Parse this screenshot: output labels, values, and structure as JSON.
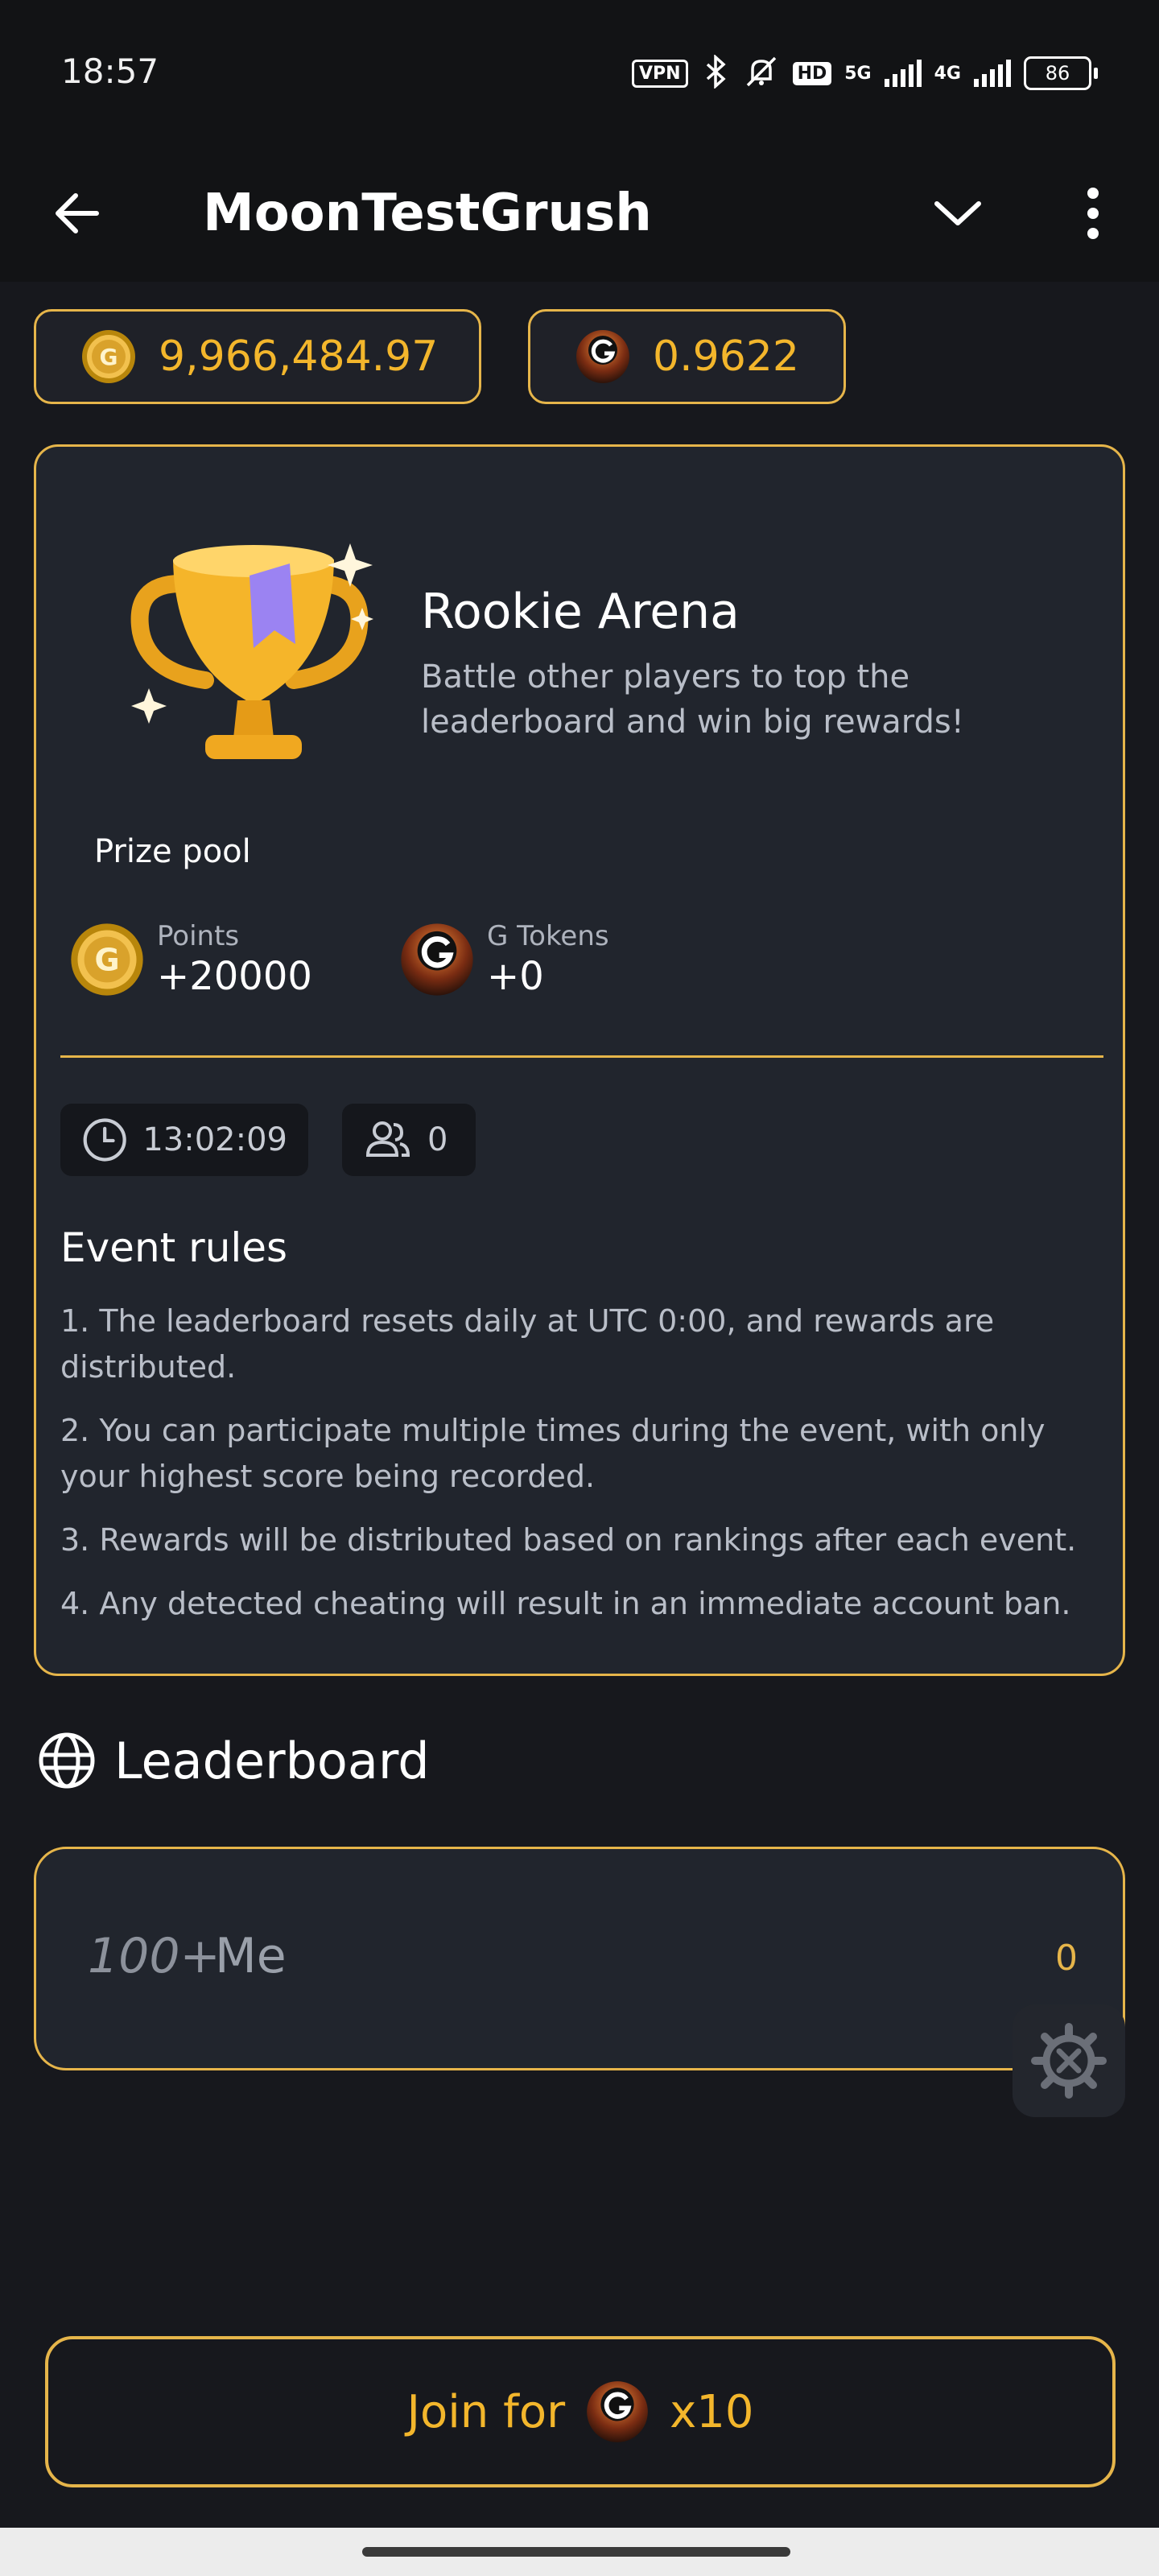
{
  "status_bar": {
    "time": "18:57",
    "vpn": "VPN",
    "hd": "HD",
    "net1": "5G",
    "net2": "4G",
    "battery": "86"
  },
  "app_bar": {
    "title": "MoonTestGrush"
  },
  "balances": {
    "points": "9,966,484.97",
    "tokens": "0.9622"
  },
  "arena": {
    "title": "Rookie Arena",
    "description": "Battle other players to top the leaderboard and win big rewards!",
    "prize_pool_label": "Prize pool",
    "prizes": [
      {
        "label": "Points",
        "amount": "+20000"
      },
      {
        "label": "G Tokens",
        "amount": "+0"
      }
    ],
    "timer": "13:02:09",
    "participants": "0",
    "rules_title": "Event rules",
    "rules": [
      "1. The leaderboard resets daily at UTC 0:00, and rewards are distributed.",
      "2. You can participate multiple times during the event, with only your highest score being recorded.",
      "3. Rewards will be distributed based on rankings after each event.",
      "4. Any detected cheating will result in an immediate account ban."
    ]
  },
  "leaderboard": {
    "title": "Leaderboard",
    "me": {
      "rank": "100+",
      "name": "Me",
      "score": "0"
    }
  },
  "join": {
    "label": "Join for",
    "cost": "x10"
  },
  "colors": {
    "accent": "#e6b54a",
    "gold_text": "#f3b62c",
    "card": "#21252d",
    "background": "#17181d"
  }
}
